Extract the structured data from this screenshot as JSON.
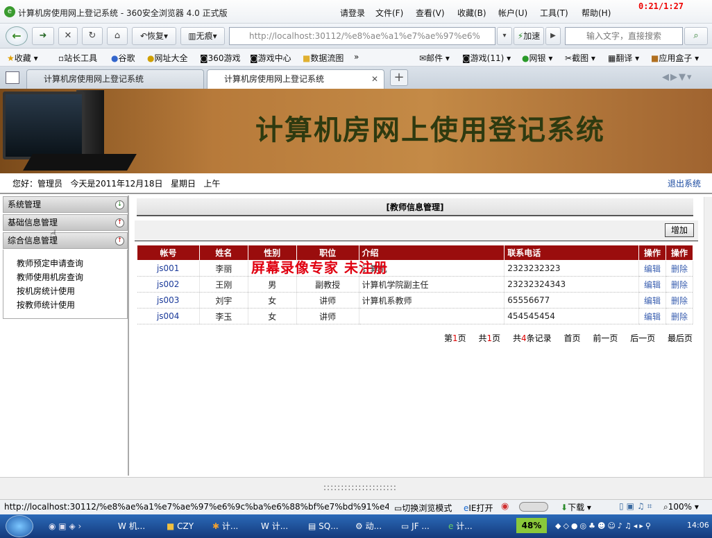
{
  "browser": {
    "title": "计算机房使用网上登记系统 - 360安全浏览器 4.0 正式版",
    "menu": [
      "请登录",
      "文件(F)",
      "查看(V)",
      "收藏(B)",
      "帐户(U)",
      "工具(T)",
      "帮助(H)"
    ],
    "recording_time": "0:21/1:27",
    "nav": {
      "restore": "恢复",
      "incognito": "无痕",
      "accelerate": "加速"
    },
    "url": "http://localhost:30112/%e8%ae%a1%e7%ae%97%e6%",
    "search_placeholder": "输入文字，直接搜索",
    "bookmarks_left": [
      "收藏",
      "站长工具",
      "谷歌",
      "网址大全",
      "360游戏",
      "游戏中心",
      "数据流图",
      "»"
    ],
    "bookmarks_right": [
      "邮件",
      "游戏(11)",
      "网银",
      "截图",
      "翻译",
      "应用盒子"
    ],
    "tabs": [
      "计算机房使用网上登记系统",
      "计算机房使用网上登记系统"
    ]
  },
  "page": {
    "banner_title": "计算机房网上使用登记系统",
    "greeting": "您好：管理员   今天是2011年12月18日   星期日   上午",
    "logout": "退出系统",
    "sidebar": {
      "sections": [
        "系统管理",
        "基础信息管理",
        "综合信息管理"
      ],
      "sub_items": [
        "教师预定申请查询",
        "教师使用机房查询",
        "按机房统计使用",
        "按教师统计使用"
      ]
    },
    "main": {
      "header": "[教师信息管理]",
      "add_button": "增加",
      "columns": [
        "帐号",
        "姓名",
        "性别",
        "职位",
        "介绍",
        "联系电话",
        "操作",
        "操作"
      ],
      "rows": [
        {
          "id": "js001",
          "name": "李丽",
          "gender": "",
          "title": "",
          "intro": "计算机",
          "phone": "2323232323",
          "edit": "编辑",
          "del": "删除"
        },
        {
          "id": "js002",
          "name": "王刚",
          "gender": "男",
          "title": "副教授",
          "intro": "计算机学院副主任",
          "phone": "23232324343",
          "edit": "编辑",
          "del": "删除"
        },
        {
          "id": "js003",
          "name": "刘宇",
          "gender": "女",
          "title": "讲师",
          "intro": "计算机系教师",
          "phone": "65556677",
          "edit": "编辑",
          "del": "删除"
        },
        {
          "id": "js004",
          "name": "李玉",
          "gender": "女",
          "title": "讲师",
          "intro": "",
          "phone": "454545454",
          "edit": "编辑",
          "del": "删除"
        }
      ],
      "pager": {
        "page_pre": "第",
        "page_num": "1",
        "page_suf": "页",
        "total_pre": "共",
        "total_num": "1",
        "total_suf": "页",
        "rec_pre": "共",
        "rec_num": "4",
        "rec_suf": "条记录",
        "first": "首页",
        "prev": "前一页",
        "next": "后一页",
        "last": "最后页"
      }
    },
    "watermark": "屏幕录像专家 未注册",
    "scroll_dots": ":::::::::::::::::::::"
  },
  "statusbar": {
    "url": "http://localhost:30112/%e8%ae%a1%e7%ae%97%e6%9c%ba%e6%88%bf%e7%bd%91%e4...",
    "items": [
      "切换浏览模式",
      "IE打开",
      "下载",
      "100%"
    ]
  },
  "taskbar": {
    "tasks": [
      "机...",
      "CZY",
      "计...",
      "计...",
      "SQ...",
      "动...",
      "JF ...",
      "计..."
    ],
    "battery": "48%",
    "clock": "14:06"
  }
}
